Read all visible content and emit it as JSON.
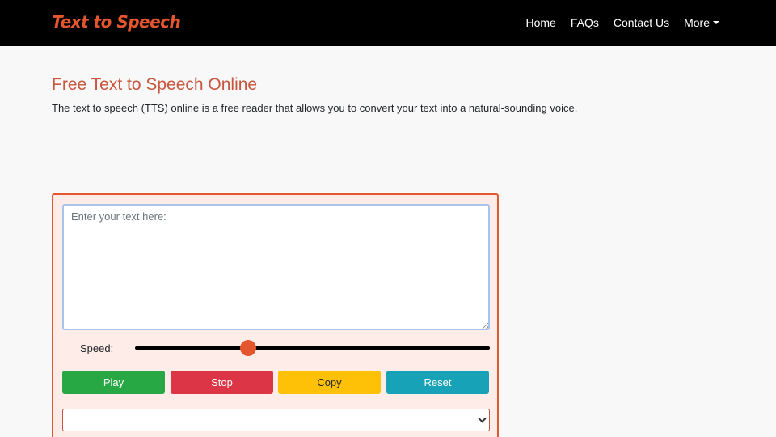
{
  "brand": "Text to Speech",
  "nav": [
    {
      "label": "Home"
    },
    {
      "label": "FAQs"
    },
    {
      "label": "Contact Us"
    },
    {
      "label": "More"
    }
  ],
  "page": {
    "title": "Free Text to Speech Online",
    "description": "The text to speech (TTS) online is a free reader that allows you to convert your text into a natural-sounding voice."
  },
  "editor": {
    "placeholder": "Enter your text here:",
    "value": ""
  },
  "speed": {
    "label": "Speed:",
    "level": 0.32
  },
  "buttons": {
    "play": "Play",
    "stop": "Stop",
    "copy": "Copy",
    "reset": "Reset"
  },
  "voice_select": {
    "selected": ""
  },
  "colors": {
    "accent": "#e4572e",
    "play": "#28a745",
    "stop": "#dc3545",
    "copy": "#ffc107",
    "reset": "#17a2b8"
  }
}
